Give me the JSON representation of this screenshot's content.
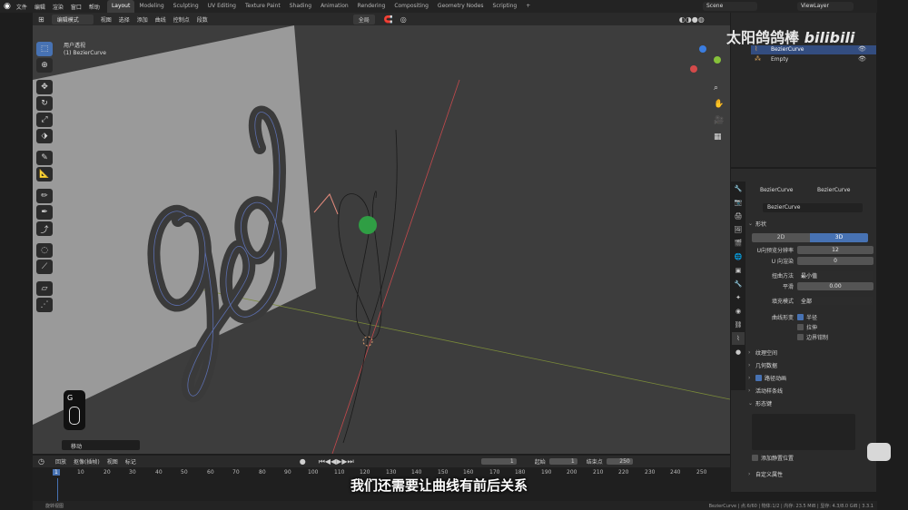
{
  "menus": [
    "文件",
    "编辑",
    "渲染",
    "窗口",
    "帮助"
  ],
  "workspace_tabs": [
    "Layout",
    "Modeling",
    "Sculpting",
    "UV Editing",
    "Texture Paint",
    "Shading",
    "Animation",
    "Rendering",
    "Compositing",
    "Geometry Nodes",
    "Scripting",
    "+"
  ],
  "active_tab": "Layout",
  "scene": "Scene",
  "view_layer": "ViewLayer",
  "header3d": {
    "mode": "编辑模式",
    "menus": [
      "视图",
      "选择",
      "添加",
      "曲线",
      "控制点",
      "段数"
    ],
    "transform": "全局"
  },
  "viewport": {
    "view_name": "用户透视",
    "object_label": "(1) BezierCurve",
    "key_hint_letter": "G",
    "op_panel": "移动"
  },
  "outliner": {
    "items": [
      "BezierCurve",
      "Empty"
    ]
  },
  "properties": {
    "breadcrumb_a": "BezierCurve",
    "breadcrumb_b": "BezierCurve",
    "datablock": "BezierCurve",
    "shape_section": "形状",
    "dim_2d": "2D",
    "dim_3d": "3D",
    "u_resolution_label": "U向预览分辨率",
    "u_resolution_value": "12",
    "u_render_label": "U 向渲染",
    "u_render_value": "0",
    "twist_method_label": "扭曲方法",
    "twist_method_value": "最小值",
    "smooth_label": "平滑",
    "smooth_value": "0.00",
    "fill_mode_label": "填充模式",
    "fill_mode_value": "全部",
    "curve_deform_label": "曲线形变",
    "opt_radius": "半径",
    "opt_stretch": "拉伸",
    "opt_bounds": "边界钳制",
    "sections": [
      "纹理空间",
      "几何数据",
      "路径动画",
      "活动样条线",
      "形态键",
      "自定义属性"
    ],
    "add_rest_pos": "添加静置位置"
  },
  "timeline": {
    "menus": [
      "回放",
      "抠像(插帧)",
      "视图",
      "标记"
    ],
    "current_frame": "1",
    "start_label": "起始",
    "start": "1",
    "end_label": "结束点",
    "end": "250",
    "ticks": [
      "1",
      "10",
      "20",
      "30",
      "40",
      "50",
      "60",
      "70",
      "80",
      "90",
      "100",
      "110",
      "120",
      "130",
      "140",
      "150",
      "160",
      "170",
      "180",
      "190",
      "200",
      "210",
      "220",
      "230",
      "240",
      "250"
    ]
  },
  "statusbar": {
    "left": "旋转视图",
    "right": "BezierCurve | 点:6/60 | 物体:1/2 | 内存: 23.5 MiB | 显存: 4.3/8.0 GiB | 3.3.1"
  },
  "subtitle": "我们还需要让曲线有前后关系",
  "watermark": "太阳鸽鸽棒",
  "brand": "bilibili",
  "colors": {
    "accent": "#4772b3",
    "viewport_bg": "#3d3d3d",
    "plane": "#9a9a9a",
    "curve_tube": "#3b3b3b",
    "red_axis": "#c4494c",
    "green_axis": "#8ab33a"
  }
}
